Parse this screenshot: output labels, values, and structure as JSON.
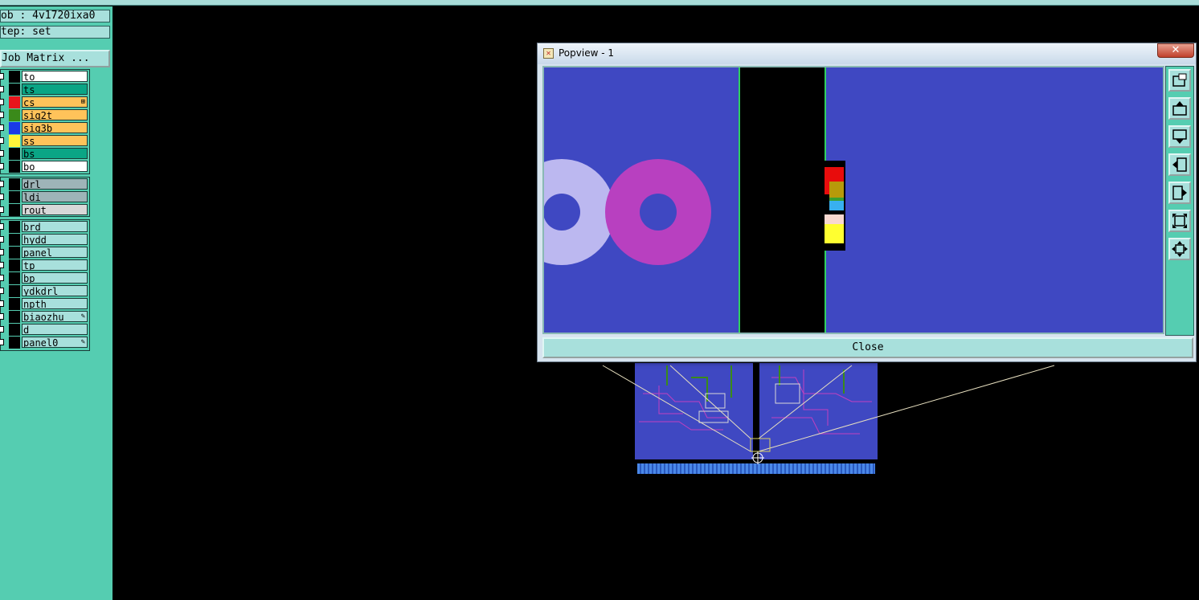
{
  "sidebar": {
    "job_label": "ob : 4v1720ixa0",
    "step_label": "tep: set",
    "job_matrix_button": "Job Matrix ...",
    "layers_group1": [
      {
        "name": "to",
        "color": "#000000",
        "bg": "#ffffff",
        "flag": ""
      },
      {
        "name": "ts",
        "color": "#000000",
        "bg": "#0aa585",
        "flag": ""
      },
      {
        "name": "cs",
        "color": "#e8141c",
        "bg": "#ffc35a",
        "flag": "⊞"
      },
      {
        "name": "sig2t",
        "color": "#3a8a1a",
        "bg": "#ffc35a",
        "flag": ""
      },
      {
        "name": "sig3b",
        "color": "#1a3ae8",
        "bg": "#ffc35a",
        "flag": ""
      },
      {
        "name": "ss",
        "color": "#fff53a",
        "bg": "#ffc35a",
        "flag": ""
      },
      {
        "name": "bs",
        "color": "#000000",
        "bg": "#0aa585",
        "flag": ""
      },
      {
        "name": "bo",
        "color": "#000000",
        "bg": "#ffffff",
        "flag": ""
      }
    ],
    "layers_group2": [
      {
        "name": "drl",
        "color": "#000000",
        "bg": "#9eb4b8",
        "flag": ""
      },
      {
        "name": "ldi",
        "color": "#000000",
        "bg": "#9eb4b8",
        "flag": ""
      },
      {
        "name": "rout",
        "color": "#000000",
        "bg": "#d8d8d8",
        "flag": ""
      }
    ],
    "layers_group3": [
      {
        "name": "brd",
        "color": "#000000",
        "bg": "#a8e0dc",
        "flag": ""
      },
      {
        "name": "hydd",
        "color": "#000000",
        "bg": "#a8e0dc",
        "flag": ""
      },
      {
        "name": "panel",
        "color": "#000000",
        "bg": "#a8e0dc",
        "flag": ""
      },
      {
        "name": "tp",
        "color": "#000000",
        "bg": "#a8e0dc",
        "flag": ""
      },
      {
        "name": "bp",
        "color": "#000000",
        "bg": "#a8e0dc",
        "flag": ""
      },
      {
        "name": "ydkdrl",
        "color": "#000000",
        "bg": "#a8e0dc",
        "flag": ""
      },
      {
        "name": "npth",
        "color": "#000000",
        "bg": "#a8e0dc",
        "flag": ""
      },
      {
        "name": "biaozhu",
        "color": "#000000",
        "bg": "#a8e0dc",
        "flag": "✎"
      },
      {
        "name": "d",
        "color": "#000000",
        "bg": "#a8e0dc",
        "flag": ""
      },
      {
        "name": "panel0",
        "color": "#000000",
        "bg": "#a8e0dc",
        "flag": "✎"
      }
    ]
  },
  "popview": {
    "title": "Popview - 1",
    "close_x": "✕",
    "close_button": "Close",
    "tools": [
      "zoom-window-icon",
      "pan-up-icon",
      "pan-down-icon",
      "pan-left-icon",
      "pan-right-icon",
      "zoom-fit-icon",
      "zoom-home-icon"
    ]
  },
  "colors": {
    "canvas_bg": "#000000",
    "board_blue": "#3f48c2",
    "panel_teal": "#55cdb1",
    "button_teal": "#a8e0dc"
  }
}
